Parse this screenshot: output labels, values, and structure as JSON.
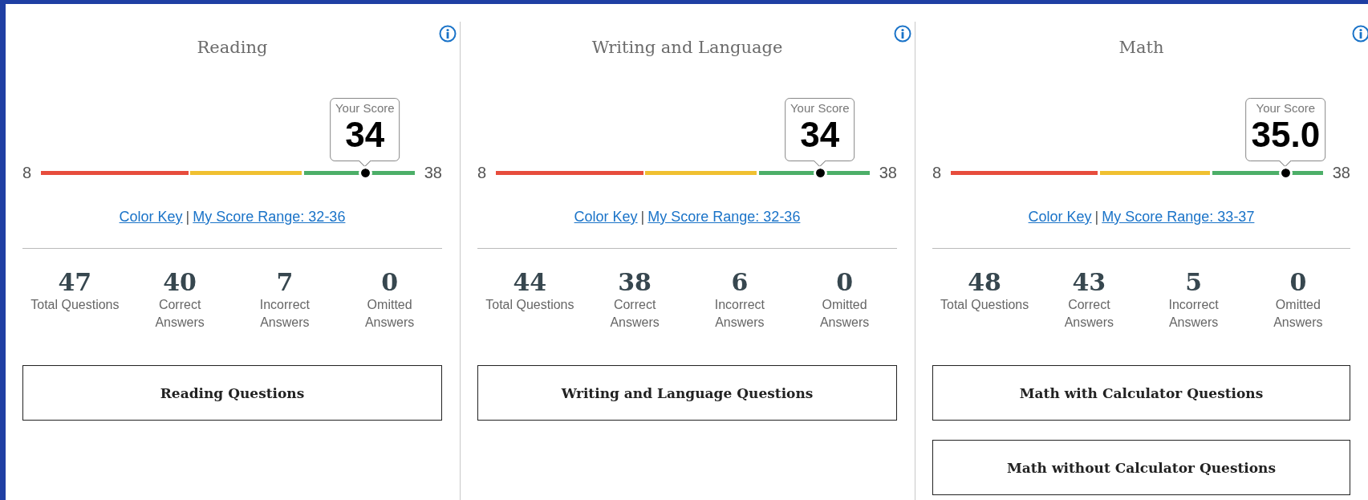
{
  "sections": [
    {
      "title": "Reading",
      "score_label": "Your Score",
      "score": "34",
      "level": 0.867,
      "scale_min": "8",
      "scale_max": "38",
      "links": [
        "Color Key",
        "My Score Range: 32-36"
      ],
      "link_separator": "|",
      "stats": [
        {
          "value": "47",
          "label": "Total Questions"
        },
        {
          "value": "40",
          "label": "Correct\nAnswers"
        },
        {
          "value": "7",
          "label": "Incorrect\nAnswers"
        },
        {
          "value": "0",
          "label": "Omitted\nAnswers"
        }
      ],
      "buttons": [
        "Reading Questions"
      ]
    },
    {
      "title": "Writing and Language",
      "score_label": "Your Score",
      "score": "34",
      "level": 0.867,
      "scale_min": "8",
      "scale_max": "38",
      "links": [
        "Color Key",
        "My Score Range: 32-36"
      ],
      "link_separator": "|",
      "stats": [
        {
          "value": "44",
          "label": "Total Questions"
        },
        {
          "value": "38",
          "label": "Correct\nAnswers"
        },
        {
          "value": "6",
          "label": "Incorrect\nAnswers"
        },
        {
          "value": "0",
          "label": "Omitted\nAnswers"
        }
      ],
      "buttons": [
        "Writing and Language Questions"
      ]
    },
    {
      "title": "Math",
      "score_label": "Your Score",
      "score": "35.0",
      "level": 0.9,
      "scale_min": "8",
      "scale_max": "38",
      "links": [
        "Color Key",
        "My Score Range: 33-37"
      ],
      "link_separator": "|",
      "stats": [
        {
          "value": "48",
          "label": "Total Questions"
        },
        {
          "value": "43",
          "label": "Correct\nAnswers"
        },
        {
          "value": "5",
          "label": "Incorrect\nAnswers"
        },
        {
          "value": "0",
          "label": "Omitted\nAnswers"
        }
      ],
      "buttons": [
        "Math with Calculator Questions",
        "Math without Calculator Questions"
      ]
    }
  ]
}
